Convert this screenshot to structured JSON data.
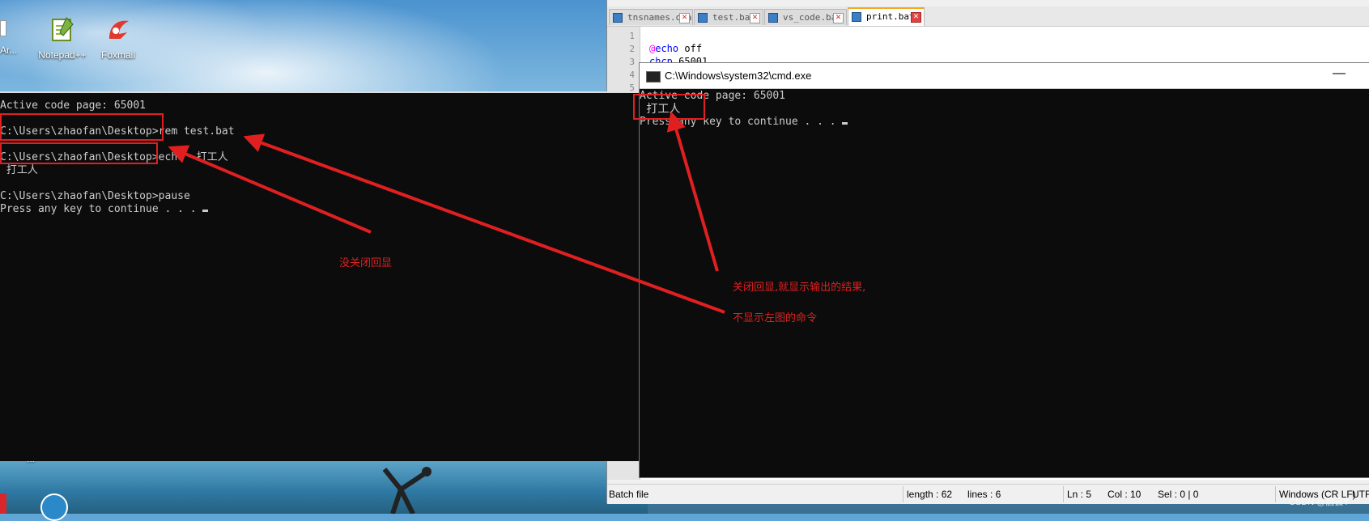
{
  "desktop": {
    "icons": [
      {
        "label": "Notepad++"
      },
      {
        "label": "Foxmail"
      }
    ],
    "partial_label": "Ar...",
    "bottom_label": "...",
    "watermark": "CSDN @启云Y"
  },
  "notepad": {
    "tabs": [
      {
        "label": "tnsnames.ora"
      },
      {
        "label": "test.bat"
      },
      {
        "label": "vs_code.bat"
      },
      {
        "label": "print.bat"
      }
    ],
    "code_lines": [
      {
        "n": "1",
        "text": ""
      },
      {
        "n": "2",
        "at": "@",
        "kw": "echo",
        "rest": " off"
      },
      {
        "n": "3",
        "kw": "chcp",
        "rest": " 65001"
      },
      {
        "n": "4",
        "text": ""
      },
      {
        "n": "5",
        "text": ""
      }
    ],
    "status": {
      "type": "Batch file",
      "length": "length : 62",
      "lines": "lines : 6",
      "ln": "Ln : 5",
      "col": "Col : 10",
      "sel": "Sel : 0 | 0",
      "eol": "Windows (CR LF)",
      "enc": "UTF-"
    }
  },
  "cmd_right": {
    "title": "C:\\Windows\\system32\\cmd.exe",
    "minimize": "—",
    "lines": [
      "Active code page: 65001",
      " 打工人",
      "Press any key to continue . . . "
    ]
  },
  "cmd_left": {
    "lines": [
      "Active code page: 65001",
      "",
      "C:\\Users\\zhaofan\\Desktop>rem test.bat",
      "",
      "C:\\Users\\zhaofan\\Desktop>echo  打工人",
      " 打工人",
      "",
      "C:\\Users\\zhaofan\\Desktop>pause",
      "Press any key to continue . . . "
    ]
  },
  "annotations": {
    "left": "没关闭回显",
    "right1": "关闭回显,就显示输出的结果,",
    "right2": "不显示左图的命令"
  },
  "colors": {
    "annotation": "#e02020",
    "terminal_bg": "#0c0c0c",
    "terminal_fg": "#cccccc"
  }
}
